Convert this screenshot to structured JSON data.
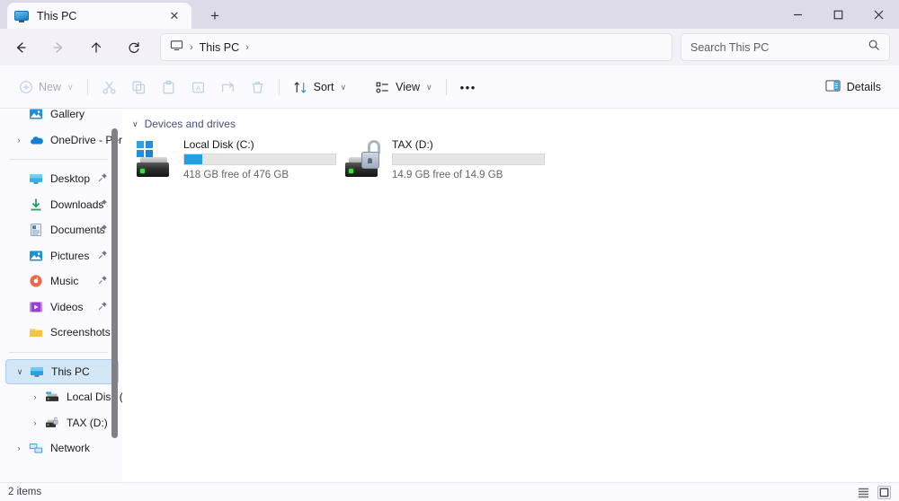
{
  "window": {
    "tab": {
      "label": "This PC",
      "icon": "monitor-icon",
      "close": "✕"
    },
    "new_tab": "+",
    "controls": {
      "minimize": "minimize-icon",
      "maximize": "maximize-icon",
      "close": "close-icon"
    }
  },
  "nav": {
    "back": "back-arrow-icon",
    "forward": "forward-arrow-icon",
    "up": "up-arrow-icon",
    "refresh": "refresh-icon",
    "breadcrumb": {
      "root_icon": "monitor-icon",
      "sep": "›",
      "item": "This PC",
      "trailing_sep": "›"
    },
    "search": {
      "placeholder": "Search This PC",
      "icon": "search-icon"
    }
  },
  "toolbar": {
    "new_label": "New",
    "cut": "cut-icon",
    "copy": "copy-icon",
    "paste": "paste-icon",
    "rename": "rename-icon",
    "share": "share-icon",
    "delete": "delete-icon",
    "sort_label": "Sort",
    "view_label": "View",
    "more_label": "•••",
    "details_label": "Details",
    "chevron": "∨"
  },
  "sidebar": {
    "items": [
      {
        "label": "Gallery",
        "icon": "gallery-icon",
        "indent": false,
        "expand": "",
        "pinned": false,
        "selected": false
      },
      {
        "label": "OneDrive - Perso",
        "icon": "onedrive-icon",
        "indent": false,
        "expand": "›",
        "pinned": false,
        "selected": false
      },
      {
        "divider": true
      },
      {
        "label": "Desktop",
        "icon": "desktop-icon",
        "indent": false,
        "expand": "",
        "pinned": true,
        "selected": false
      },
      {
        "label": "Downloads",
        "icon": "downloads-icon",
        "indent": false,
        "expand": "",
        "pinned": true,
        "selected": false
      },
      {
        "label": "Documents",
        "icon": "documents-icon",
        "indent": false,
        "expand": "",
        "pinned": true,
        "selected": false
      },
      {
        "label": "Pictures",
        "icon": "pictures-icon",
        "indent": false,
        "expand": "",
        "pinned": true,
        "selected": false
      },
      {
        "label": "Music",
        "icon": "music-icon",
        "indent": false,
        "expand": "",
        "pinned": true,
        "selected": false
      },
      {
        "label": "Videos",
        "icon": "videos-icon",
        "indent": false,
        "expand": "",
        "pinned": true,
        "selected": false
      },
      {
        "label": "Screenshots",
        "icon": "folder-icon",
        "indent": false,
        "expand": "",
        "pinned": false,
        "selected": false
      },
      {
        "divider": true
      },
      {
        "label": "This PC",
        "icon": "this-pc-icon",
        "indent": false,
        "expand": "∨",
        "pinned": false,
        "selected": true
      },
      {
        "label": "Local Disk (C:)",
        "icon": "drive-c-icon",
        "indent": true,
        "expand": "›",
        "pinned": false,
        "selected": false
      },
      {
        "label": "TAX (D:)",
        "icon": "drive-d-icon",
        "indent": true,
        "expand": "›",
        "pinned": false,
        "selected": false
      },
      {
        "label": "Network",
        "icon": "network-icon",
        "indent": false,
        "expand": "›",
        "pinned": false,
        "selected": false
      }
    ]
  },
  "content": {
    "group_title": "Devices and drives",
    "group_chevron": "∨",
    "drives": [
      {
        "name": "Local Disk (C:)",
        "free_text": "418 GB free of 476 GB",
        "used_percent": 12,
        "icon": "windows-drive-icon",
        "bar_color": "#1ea1e2"
      },
      {
        "name": "TAX (D:)",
        "free_text": "14.9 GB free of 14.9 GB",
        "used_percent": 0,
        "icon": "bitlocker-unlocked-drive-icon",
        "bar_color": "#1ea1e2"
      }
    ]
  },
  "status": {
    "item_count": "2 items",
    "list_view": "list-view-icon",
    "tiles_view": "tiles-view-icon"
  }
}
